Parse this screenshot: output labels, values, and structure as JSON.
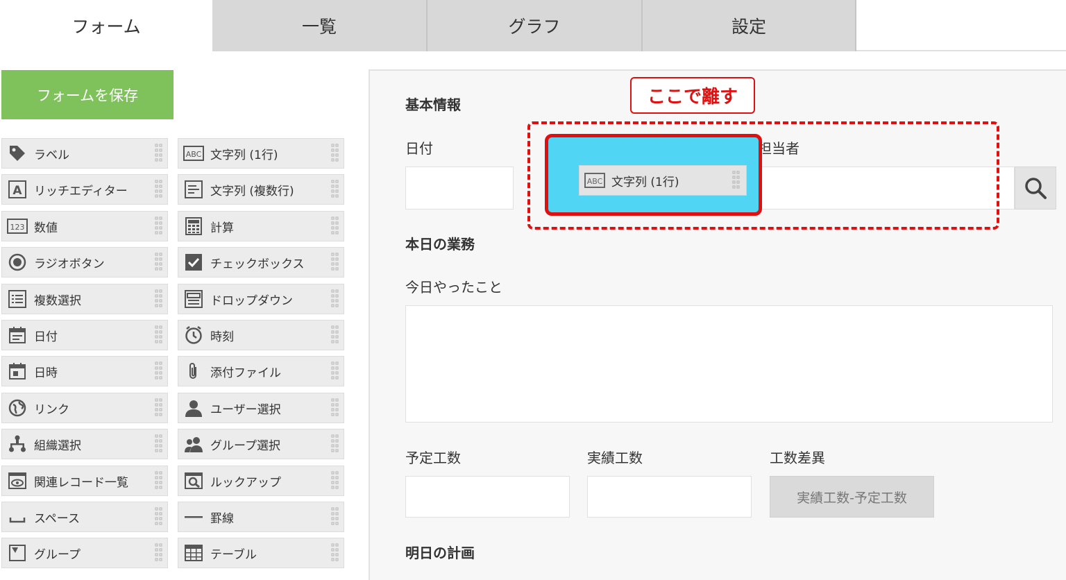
{
  "tabs": [
    {
      "label": "フォーム",
      "active": true
    },
    {
      "label": "一覧",
      "active": false
    },
    {
      "label": "グラフ",
      "active": false
    },
    {
      "label": "設定",
      "active": false
    }
  ],
  "save_button": "フォームを保存",
  "palette": {
    "left": [
      {
        "label": "ラベル",
        "icon": "tag-icon"
      },
      {
        "label": "リッチエディター",
        "icon": "rich-editor-icon"
      },
      {
        "label": "数値",
        "icon": "number-icon"
      },
      {
        "label": "ラジオボタン",
        "icon": "radio-icon"
      },
      {
        "label": "複数選択",
        "icon": "multi-select-icon"
      },
      {
        "label": "日付",
        "icon": "calendar-icon"
      },
      {
        "label": "日時",
        "icon": "datetime-icon"
      },
      {
        "label": "リンク",
        "icon": "globe-icon"
      },
      {
        "label": "組織選択",
        "icon": "org-icon"
      },
      {
        "label": "関連レコード一覧",
        "icon": "related-records-icon"
      },
      {
        "label": "スペース",
        "icon": "space-icon"
      },
      {
        "label": "グループ",
        "icon": "group-field-icon"
      }
    ],
    "right": [
      {
        "label": "文字列 (1行)",
        "icon": "abc-icon"
      },
      {
        "label": "文字列 (複数行)",
        "icon": "multiline-text-icon"
      },
      {
        "label": "計算",
        "icon": "calculator-icon"
      },
      {
        "label": "チェックボックス",
        "icon": "checkbox-icon"
      },
      {
        "label": "ドロップダウン",
        "icon": "dropdown-icon"
      },
      {
        "label": "時刻",
        "icon": "clock-icon"
      },
      {
        "label": "添付ファイル",
        "icon": "paperclip-icon"
      },
      {
        "label": "ユーザー選択",
        "icon": "user-icon"
      },
      {
        "label": "グループ選択",
        "icon": "users-icon"
      },
      {
        "label": "ルックアップ",
        "icon": "lookup-icon"
      },
      {
        "label": "罫線",
        "icon": "line-icon"
      },
      {
        "label": "テーブル",
        "icon": "table-icon"
      }
    ]
  },
  "form": {
    "section_basic": "基本情報",
    "date_label": "日付",
    "assignee_label": "担当者",
    "section_today": "本日の業務",
    "today_done_label": "今日やったこと",
    "planned_label": "予定工数",
    "actual_label": "実績工数",
    "diff_label": "工数差異",
    "diff_formula": "実績工数-予定工数",
    "section_tomorrow": "明日の計画"
  },
  "annotation": {
    "callout": "ここで離す",
    "dragged_label": "文字列 (1行)"
  },
  "colors": {
    "save_green": "#7fc25c",
    "drop_cyan": "#50d6f4",
    "annotation_red": "#e01010"
  }
}
